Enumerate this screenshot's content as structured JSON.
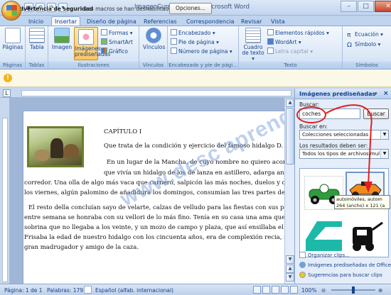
{
  "window": {
    "title": "ImagenCurso01.docx - Microsoft Word",
    "controls": {
      "minimize": "–",
      "maximize": "□",
      "close": "✕"
    }
  },
  "qat": {
    "save_icon": "save-icon",
    "undo": "↶",
    "redo": "↷",
    "more": "▾"
  },
  "tabs": [
    "Inicio",
    "Insertar",
    "Diseño de página",
    "Referencias",
    "Correspondencia",
    "Revisar",
    "Vista"
  ],
  "active_tab": "Insertar",
  "ribbon": {
    "groups": [
      {
        "label": "Páginas",
        "buttons": [
          "Páginas"
        ]
      },
      {
        "label": "Tablas",
        "buttons": [
          "Tabla"
        ]
      },
      {
        "label": "Ilustraciones",
        "big": [
          "Imagen",
          "Imágenes prediseñadas"
        ],
        "small": [
          "Formas ▾",
          "SmartArt",
          "Gráfico"
        ]
      },
      {
        "label": "Vínculos",
        "buttons": [
          "Vínculos"
        ]
      },
      {
        "label": "Encabezado y pie de pági...",
        "small": [
          "Encabezado ▾",
          "Pie de página ▾",
          "Número de página ▾"
        ]
      },
      {
        "label": "Texto",
        "big": [
          "Cuadro de texto ▾"
        ],
        "small": [
          "Elementos rápidos ▾",
          "WordArt ▾",
          "Letra capital ▾"
        ]
      },
      {
        "label": "Símbolos",
        "small": [
          "Ecuación ▾",
          "Símbolo ▾"
        ]
      }
    ]
  },
  "security_bar": {
    "title": "Advertencia de seguridad",
    "message": "Las macros se han deshabilitado.",
    "button": "Opciones..."
  },
  "document": {
    "lines": [
      "CAPÍTULO I",
      "Que trata de la condición y ejercicio del famoso hidalgo D. Quijote",
      "En un lugar de la Mancha, de cuyo nombre no quiero acordarm",
      "que vivía un hidalgo de los de lanza en astillero, adarga antig",
      "corredor. Una olla de algo más vaca que carnero, salpicón las más noches, duelos y quebrant",
      "los viernes, algún palomino de añadidura los domingos, consumían las tres partes de su hacie",
      "El resto della concluían sayo de velarte, calzas de velludo para las fiestas con sus pantuflos d",
      "entre semana se honraba con su vellori de lo más fino. Tenía en su casa una ama que pasaba",
      "sobrina que no llegaba a los veinte, y un mozo de campo y plaza, que así ensillaba el rocín com",
      "Frisaba la edad de nuestro hidalgo con los cincuenta años, era de complexión recia, seco de ca",
      "gran madrugador y amigo de la caza."
    ],
    "watermark": "www.desc'aprende.com"
  },
  "task_pane": {
    "title": "Imágenes prediseñadas",
    "search_label": "Buscar:",
    "search_value": "coches",
    "search_button": "Buscar",
    "search_in_label": "Buscar en:",
    "search_in_value": "Colecciones seleccionadas",
    "results_label": "Los resultados deben ser:",
    "results_value": "Todos los tipos de archivos mul",
    "tooltip": [
      "automóviles, autom",
      "264 (ancho) x 121 (a"
    ],
    "links": [
      "Organizar clips...",
      "Imágenes prediseñadas de Office O",
      "Sugerencias para buscar clips"
    ]
  },
  "status_bar": {
    "page": "Página: 1 de 1",
    "words": "Palabras: 179",
    "language": "Español (alfab. internacional)",
    "zoom": "100%"
  }
}
